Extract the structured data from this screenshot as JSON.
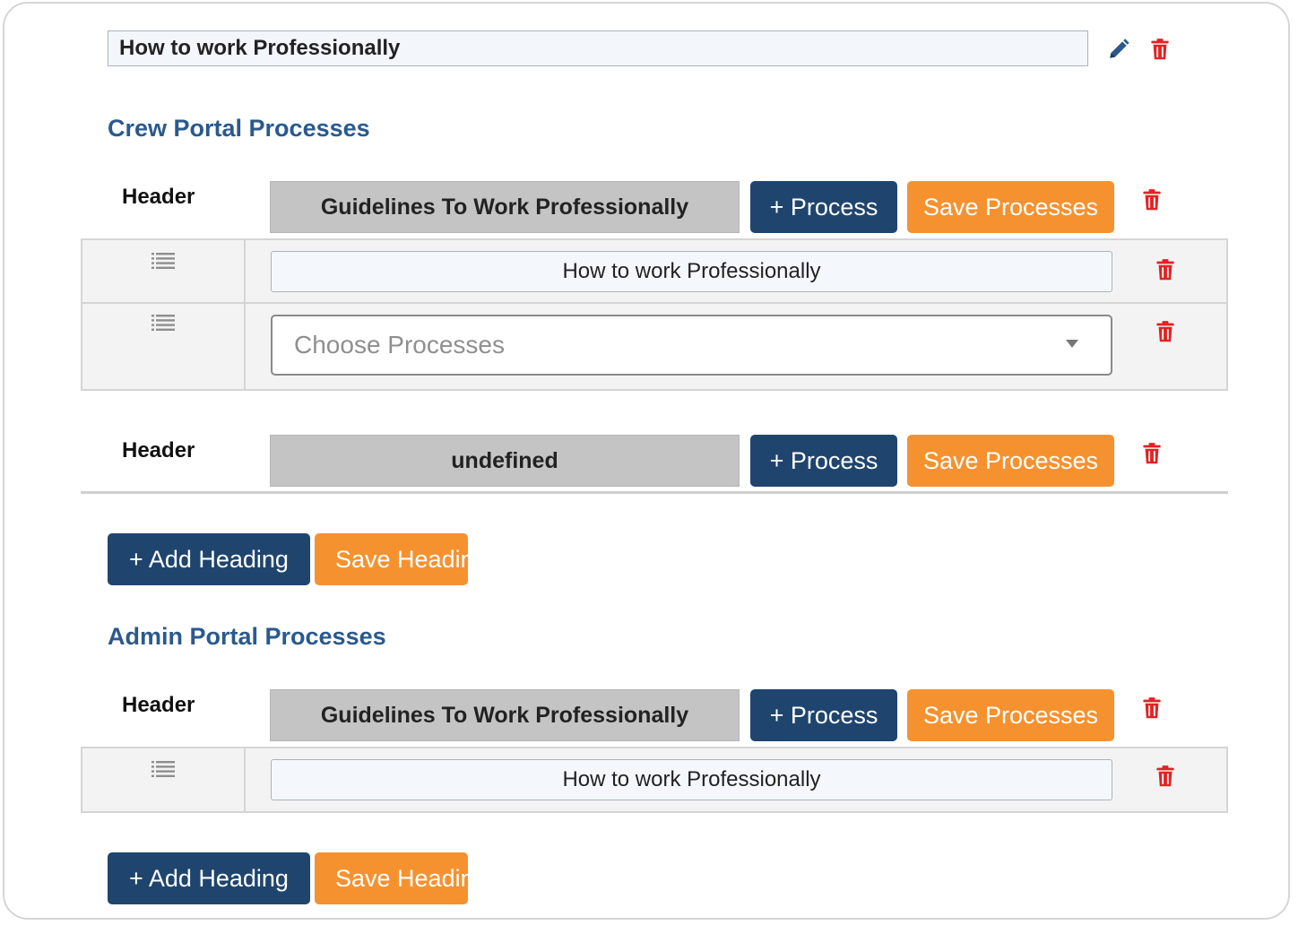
{
  "top": {
    "title_value": "How to work Professionally"
  },
  "colors": {
    "navy": "#1f456e",
    "orange": "#f5922f",
    "danger": "#e02424",
    "section_title": "#2a5a8c"
  },
  "crew": {
    "section_title": "Crew Portal Processes",
    "groups": [
      {
        "header_label": "Header",
        "header_value": "Guidelines To Work Professionally",
        "add_process_label": "+ Process",
        "save_processes_label": "Save Processes",
        "items": [
          {
            "value": "How to work Professionally"
          }
        ],
        "select_placeholder": "Choose Processes"
      },
      {
        "header_label": "Header",
        "header_value": "undefined",
        "add_process_label": "+ Process",
        "save_processes_label": "Save Processes"
      }
    ],
    "add_heading_label": "+ Add Heading",
    "save_heading_label": "Save Heading"
  },
  "admin": {
    "section_title": "Admin Portal Processes",
    "groups": [
      {
        "header_label": "Header",
        "header_value": "Guidelines To Work Professionally",
        "add_process_label": "+ Process",
        "save_processes_label": "Save Processes",
        "items": [
          {
            "value": "How to work Professionally"
          }
        ]
      }
    ],
    "add_heading_label": "+ Add Heading",
    "save_heading_label": "Save Heading"
  }
}
